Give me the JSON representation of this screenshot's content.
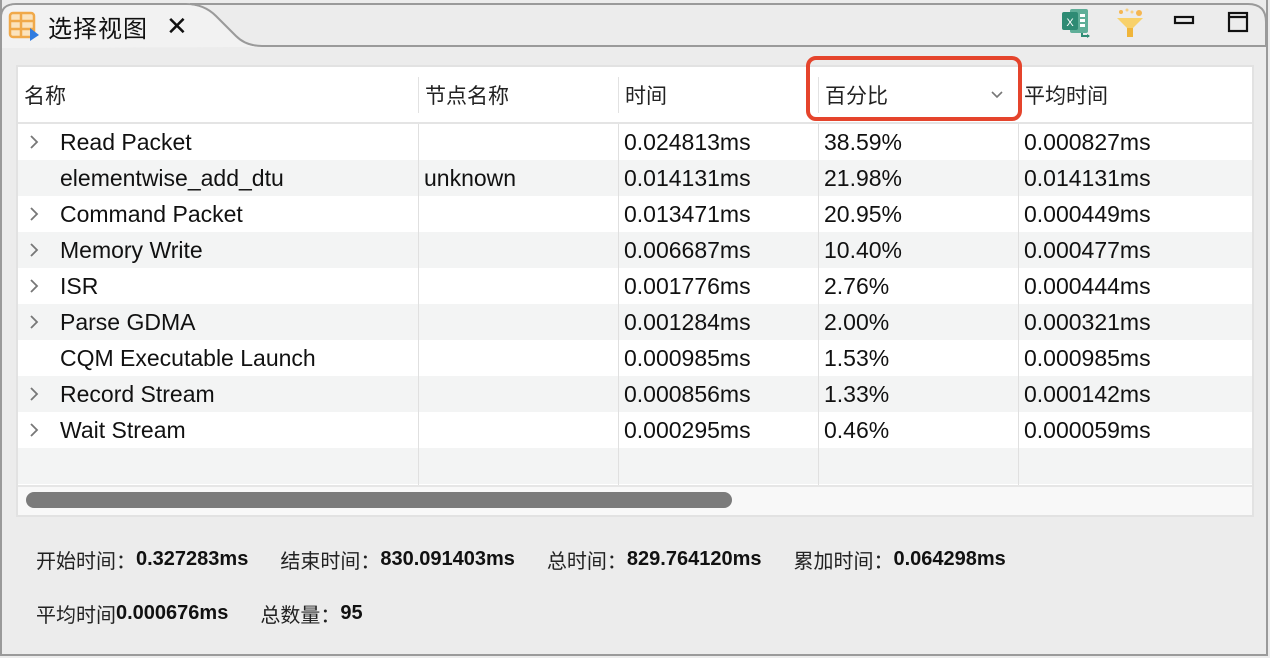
{
  "tab": {
    "title": "选择视图",
    "icon": "table-view-icon",
    "close_icon": "close-icon"
  },
  "toolbar": {
    "buttons": [
      {
        "name": "export-excel-button",
        "icon": "excel-icon"
      },
      {
        "name": "filter-button",
        "icon": "funnel-icon"
      },
      {
        "name": "minimize-button",
        "icon": "minimize-icon"
      },
      {
        "name": "maximize-button",
        "icon": "maximize-icon"
      }
    ]
  },
  "table": {
    "columns": [
      {
        "label": "名称"
      },
      {
        "label": "节点名称"
      },
      {
        "label": "时间"
      },
      {
        "label": "百分比",
        "sortable": true,
        "sort_icon": "chevron-down-icon",
        "highlighted": true
      },
      {
        "label": "平均时间"
      }
    ],
    "rows": [
      {
        "name": "Read Packet",
        "node": "",
        "time": "0.024813ms",
        "percent": "38.59%",
        "avg": "0.000827ms",
        "expandable": true
      },
      {
        "name": "elementwise_add_dtu",
        "node": "unknown",
        "time": "0.014131ms",
        "percent": "21.98%",
        "avg": "0.014131ms",
        "expandable": false
      },
      {
        "name": "Command Packet",
        "node": "",
        "time": "0.013471ms",
        "percent": "20.95%",
        "avg": "0.000449ms",
        "expandable": true
      },
      {
        "name": "Memory Write",
        "node": "",
        "time": "0.006687ms",
        "percent": "10.40%",
        "avg": "0.000477ms",
        "expandable": true
      },
      {
        "name": "ISR",
        "node": "",
        "time": "0.001776ms",
        "percent": "2.76%",
        "avg": "0.000444ms",
        "expandable": true
      },
      {
        "name": "Parse GDMA",
        "node": "",
        "time": "0.001284ms",
        "percent": "2.00%",
        "avg": "0.000321ms",
        "expandable": true
      },
      {
        "name": "CQM Executable Launch",
        "node": "",
        "time": "0.000985ms",
        "percent": "1.53%",
        "avg": "0.000985ms",
        "expandable": false
      },
      {
        "name": "Record Stream",
        "node": "",
        "time": "0.000856ms",
        "percent": "1.33%",
        "avg": "0.000142ms",
        "expandable": true
      },
      {
        "name": "Wait Stream",
        "node": "",
        "time": "0.000295ms",
        "percent": "0.46%",
        "avg": "0.000059ms",
        "expandable": true
      }
    ],
    "scroll": {
      "horizontal_thumb_fraction": 0.58,
      "position_fraction": 0.0
    }
  },
  "summary": {
    "line1": [
      {
        "label": "开始时间：",
        "value": "0.327283ms"
      },
      {
        "label": "结束时间：",
        "value": "830.091403ms"
      },
      {
        "label": "总时间：",
        "value": "829.764120ms"
      },
      {
        "label": "累加时间：",
        "value": "0.064298ms"
      }
    ],
    "line2": [
      {
        "label": "平均时间 ",
        "value": "0.000676ms"
      },
      {
        "label": "总数量：",
        "value": "95"
      }
    ]
  },
  "colors": {
    "highlight": "#e5442c",
    "scroll_thumb": "#7b7b7b",
    "row_alt": "#f3f4f4",
    "excel_green": "#2e8b74",
    "tab_icon_orange": "#f0a94a",
    "tab_icon_blue": "#2f7be0"
  }
}
